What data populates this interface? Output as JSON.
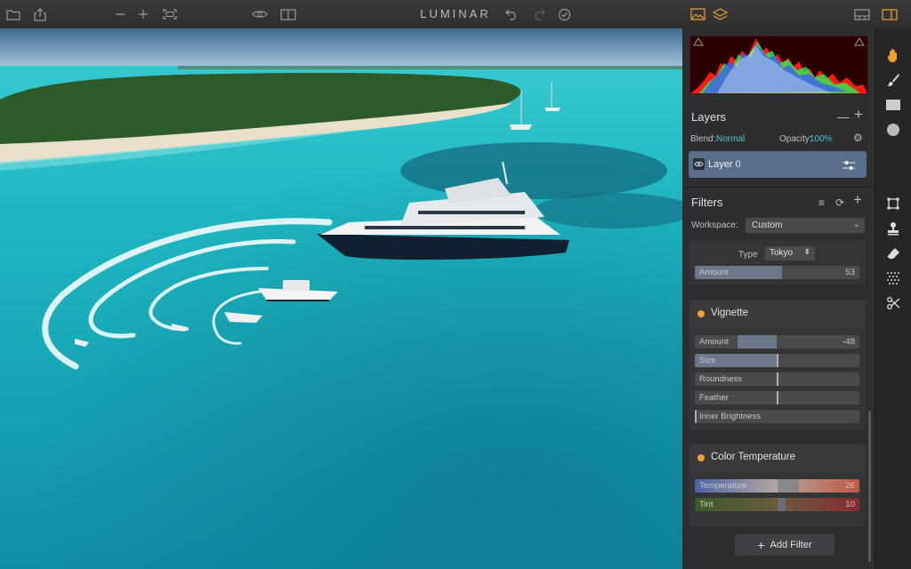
{
  "app": {
    "title": "LUMINAR"
  },
  "toolbar": {
    "open_icon": "folder-icon",
    "share_icon": "share-icon",
    "zoom_out_icon": "minus-icon",
    "zoom_in_icon": "plus-icon",
    "fit_icon": "fit-screen-icon",
    "preview_icon": "eye-icon",
    "compare_icon": "split-view-icon",
    "undo_icon": "undo-icon",
    "redo_icon": "redo-icon",
    "history_icon": "history-icon",
    "accent_color": "#f0a030"
  },
  "layers": {
    "title": "Layers",
    "blend_label": "Blend:",
    "blend_value": "Normal",
    "opacity_label": "Opacity:",
    "opacity_value": "100%",
    "layer_name": "Layer 0"
  },
  "filters": {
    "title": "Filters",
    "workspace_label": "Workspace:",
    "workspace_value": "Custom",
    "type_label": "Type",
    "type_value": "Tokyo",
    "top_amount": {
      "label": "Amount",
      "value": "53",
      "fraction": 0.53
    },
    "vignette": {
      "name": "Vignette",
      "amount": {
        "label": "Amount",
        "value": "-48",
        "fraction": 0.26
      },
      "size": {
        "label": "Size",
        "fraction": 0.5
      },
      "roundness": {
        "label": "Roundness",
        "fraction": 0.5
      },
      "feather": {
        "label": "Feather",
        "fraction": 0.5
      },
      "inner_brightness": {
        "label": "Inner Brightness",
        "fraction": 0.0
      }
    },
    "color_temperature": {
      "name": "Color Temperature",
      "temperature": {
        "label": "Temperature",
        "value": "26",
        "fraction": 0.63
      },
      "tint": {
        "label": "Tint",
        "value": "10",
        "fraction": 0.55
      }
    },
    "add_filter_label": "Add Filter"
  }
}
